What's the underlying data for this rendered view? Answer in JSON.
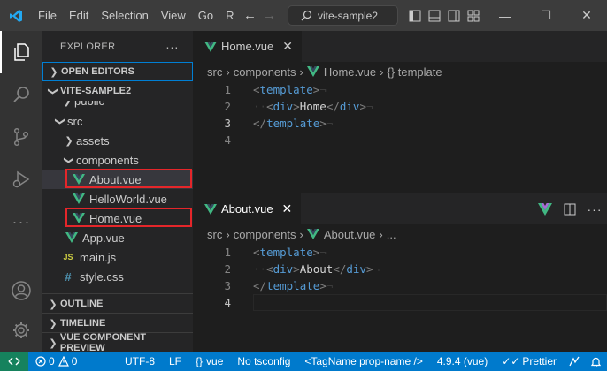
{
  "menu": [
    "File",
    "Edit",
    "Selection",
    "View",
    "Go",
    "R"
  ],
  "search": {
    "label": "vite-sample2"
  },
  "explorer": {
    "title": "EXPLORER",
    "more": "···",
    "open_editors": "OPEN EDITORS",
    "project": "VITE-SAMPLE2",
    "tree": {
      "public": "public",
      "src": "src",
      "assets": "assets",
      "components": "components",
      "about": "About.vue",
      "helloworld": "HelloWorld.vue",
      "home": "Home.vue",
      "app": "App.vue",
      "mainjs": "main.js",
      "stylecss": "style.css",
      "js_badge": "JS",
      "css_badge": "#"
    },
    "outline": "OUTLINE",
    "timeline": "TIMELINE",
    "vue_preview": "VUE COMPONENT PREVIEW"
  },
  "editor_top": {
    "tab": "Home.vue",
    "breadcrumb": [
      "src",
      "components",
      "Home.vue",
      "{} template"
    ],
    "lines": [
      {
        "n": "1",
        "open": "<",
        "tag": "template",
        "close": ">",
        "inner": ""
      },
      {
        "n": "2",
        "open": "<",
        "tag": "div",
        "close": ">",
        "inner": "Home"
      },
      {
        "n": "3",
        "open": "</",
        "tag": "template",
        "close": ">",
        "inner": ""
      },
      {
        "n": "4"
      }
    ]
  },
  "editor_bottom": {
    "tab": "About.vue",
    "breadcrumb": [
      "src",
      "components",
      "About.vue",
      "..."
    ],
    "lines": [
      {
        "n": "1",
        "open": "<",
        "tag": "template",
        "close": ">",
        "inner": ""
      },
      {
        "n": "2",
        "open": "<",
        "tag": "div",
        "close": ">",
        "inner": "About"
      },
      {
        "n": "3",
        "open": "</",
        "tag": "template",
        "close": ">",
        "inner": ""
      },
      {
        "n": "4"
      }
    ]
  },
  "status": {
    "errors": "0",
    "warnings": "0",
    "encoding": "UTF-8",
    "eol": "LF",
    "language": "vue",
    "tsconfig": "No tsconfig",
    "tagname": "<TagName prop-name />",
    "version": "4.9.4 (vue)",
    "prettier": "Prettier"
  },
  "colors": {
    "accent": "#007acc",
    "highlight_box": "#e5262a",
    "vue_green": "#41b883"
  }
}
